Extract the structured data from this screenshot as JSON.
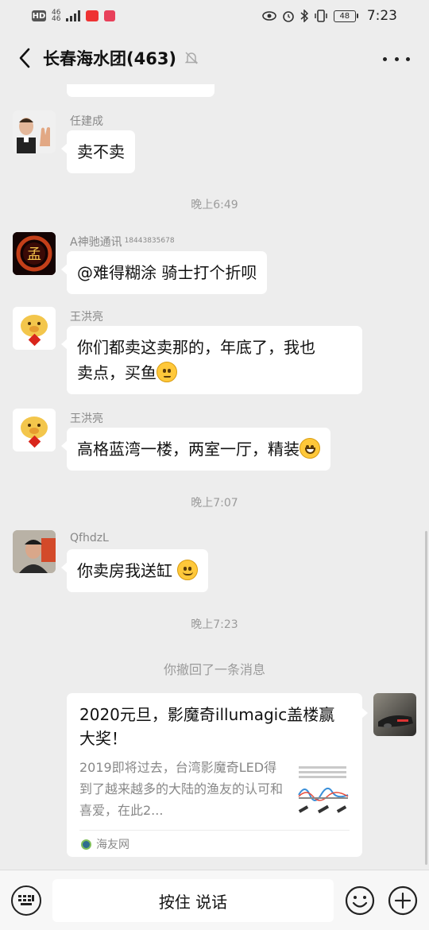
{
  "status_bar": {
    "hd": "HD",
    "net_top": "46",
    "net_bottom": "46",
    "battery": "48",
    "time": "7:23"
  },
  "nav": {
    "title": "长春海水团(463)"
  },
  "messages": [
    {
      "sender": "任建成",
      "text": "卖不卖"
    },
    {
      "sender": "A神驰通讯",
      "sender_extra": "18443835678",
      "text": "@难得糊涂  骑士打个折呗"
    },
    {
      "sender": "王洪亮",
      "line1": "你们都卖这卖那的，年底了，我也",
      "line2": "卖点，买鱼"
    },
    {
      "sender": "王洪亮",
      "text": "高格蓝湾一楼，两室一厅，精装"
    },
    {
      "sender": "QfhdzL",
      "text": "你卖房我送缸 "
    }
  ],
  "time_separators": [
    "晚上6:49",
    "晚上7:07",
    "晚上7:23"
  ],
  "system_note": "你撤回了一条消息",
  "link_card": {
    "title": "2020元旦，影魔奇illumagic盖楼赢大奖！",
    "description": "2019即将过去，台湾影魔奇LED得到了越来越多的大陆的渔友的认可和喜爱，在此2...",
    "source": "海友网"
  },
  "input_bar": {
    "hold_to_talk": "按住 说话"
  },
  "avatar_seal_char": "孟",
  "icons": [
    "back-arrow-icon",
    "mute-bell-icon",
    "more-dots-icon",
    "keyboard-icon",
    "emoji-icon",
    "plus-icon"
  ]
}
